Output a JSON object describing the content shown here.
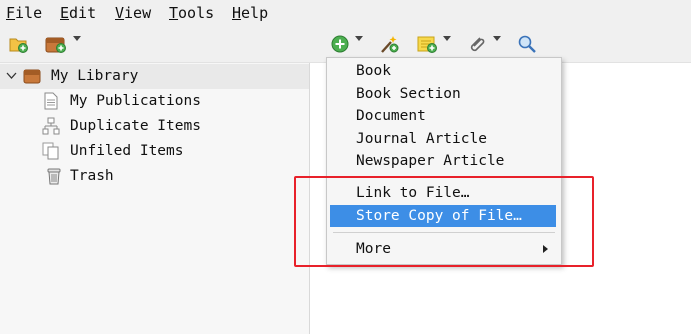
{
  "menubar": {
    "items": [
      {
        "label": "File"
      },
      {
        "label": "Edit"
      },
      {
        "label": "View"
      },
      {
        "label": "Tools"
      },
      {
        "label": "Help"
      }
    ]
  },
  "toolbar": {
    "icons": [
      "new-collection-icon",
      "new-library-icon",
      "new-item-icon",
      "add-by-identifier-icon",
      "new-note-icon",
      "add-attachment-icon",
      "locate-icon"
    ]
  },
  "library": {
    "root_label": "My Library",
    "items": [
      {
        "label": "My Publications",
        "icon": "publications-icon"
      },
      {
        "label": "Duplicate Items",
        "icon": "duplicate-icon"
      },
      {
        "label": "Unfiled Items",
        "icon": "unfiled-icon"
      },
      {
        "label": "Trash",
        "icon": "trash-icon"
      }
    ]
  },
  "new_item_menu": {
    "items": [
      {
        "label": "Book"
      },
      {
        "label": "Book Section"
      },
      {
        "label": "Document"
      },
      {
        "label": "Journal Article"
      },
      {
        "label": "Newspaper Article"
      }
    ],
    "attachment_items": [
      {
        "label": "Link to File…"
      },
      {
        "label": "Store Copy of File…"
      }
    ],
    "more_label": "More",
    "highlighted": "Store Copy of File…"
  },
  "colors": {
    "highlight": "#3d8ee6",
    "annotation": "#e8212a",
    "menubar_bg": "#f0f0f0"
  }
}
